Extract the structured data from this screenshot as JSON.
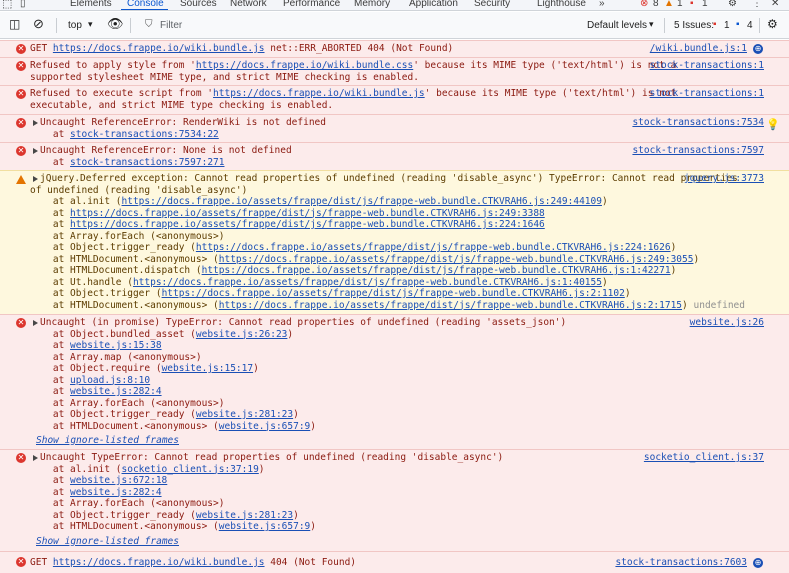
{
  "tabs": [
    "Elements",
    "Console",
    "Sources",
    "Network",
    "Performance",
    "Memory",
    "Application",
    "Security",
    "Lighthouse"
  ],
  "more_tabs": "»",
  "tab_counts": {
    "errors": "8",
    "warnings": "1",
    "info": "1"
  },
  "toolbar": {
    "context": "top",
    "filter_placeholder": "Filter",
    "levels": "Default levels",
    "issues_label": "5 Issues:",
    "issues_err": "1",
    "issues_info": "4"
  },
  "m1": {
    "pre": "GET ",
    "url": "https://docs.frappe.io/wiki.bundle.js",
    "post": " net::ERR_ABORTED 404 (Not Found)",
    "src": "/wiki.bundle.js:1"
  },
  "m2": {
    "l1a": "Refused to apply style from '",
    "l1url": "https://docs.frappe.io/wiki.bundle.css",
    "l1b": "' because its MIME type ('text/html') is not a",
    "l2": "supported stylesheet MIME type, and strict MIME checking is enabled.",
    "src": "stock-transactions:1"
  },
  "m3": {
    "l1a": "Refused to execute script from '",
    "l1url": "https://docs.frappe.io/wiki.bundle.js",
    "l1b": "' because its MIME type ('text/html') is not",
    "l2": "executable, and strict MIME type checking is enabled.",
    "src": "stock-transactions:1"
  },
  "m4": {
    "l1": "Uncaught ReferenceError: RenderWiki is not defined",
    "l2a": "    at ",
    "l2url": "stock-transactions:7534:22",
    "src": "stock-transactions:7534"
  },
  "m5": {
    "l1": "Uncaught ReferenceError: None is not defined",
    "l2a": "    at ",
    "l2url": "stock-transactions:7597:271",
    "src": "stock-transactions:7597"
  },
  "m6": {
    "l1": "jQuery.Deferred exception: Cannot read properties of undefined (reading 'disable_async') TypeError: Cannot read properties",
    "l2": "of undefined (reading 'disable_async')",
    "src": "jquery.js:3773",
    "frames": [
      {
        "a": "    at al.init (",
        "u": "https://docs.frappe.io/assets/frappe/dist/js/frappe-web.bundle.CTKVRAH6.js:249:44109",
        "b": ")"
      },
      {
        "a": "    at ",
        "u": "https://docs.frappe.io/assets/frappe/dist/js/frappe-web.bundle.CTKVRAH6.js:249:3388",
        "b": ""
      },
      {
        "a": "    at ",
        "u": "https://docs.frappe.io/assets/frappe/dist/js/frappe-web.bundle.CTKVRAH6.js:224:1646",
        "b": ""
      },
      {
        "a": "    at Array.forEach (<anonymous>)",
        "u": "",
        "b": ""
      },
      {
        "a": "    at Object.trigger_ready (",
        "u": "https://docs.frappe.io/assets/frappe/dist/js/frappe-web.bundle.CTKVRAH6.js:224:1626",
        "b": ")"
      },
      {
        "a": "    at HTMLDocument.<anonymous> (",
        "u": "https://docs.frappe.io/assets/frappe/dist/js/frappe-web.bundle.CTKVRAH6.js:249:3055",
        "b": ")"
      },
      {
        "a": "    at HTMLDocument.dispatch (",
        "u": "https://docs.frappe.io/assets/frappe/dist/js/frappe-web.bundle.CTKVRAH6.js:1:42271",
        "b": ")"
      },
      {
        "a": "    at Ut.handle (",
        "u": "https://docs.frappe.io/assets/frappe/dist/js/frappe-web.bundle.CTKVRAH6.js:1:40155",
        "b": ")"
      },
      {
        "a": "    at Object.trigger (",
        "u": "https://docs.frappe.io/assets/frappe/dist/js/frappe-web.bundle.CTKVRAH6.js:2:1102",
        "b": ")"
      },
      {
        "a": "    at HTMLDocument.<anonymous> (",
        "u": "https://docs.frappe.io/assets/frappe/dist/js/frappe-web.bundle.CTKVRAH6.js:2:1715",
        "b": ")"
      }
    ],
    "tail": "undefined"
  },
  "m7": {
    "l1": "Uncaught (in promise) TypeError: Cannot read properties of undefined (reading 'assets_json')",
    "src": "website.js:26",
    "frames": [
      {
        "a": "    at Object.bundled_asset (",
        "u": "website.js:26:23",
        "b": ")"
      },
      {
        "a": "    at ",
        "u": "website.js:15:38",
        "b": ""
      },
      {
        "a": "    at Array.map (<anonymous>)",
        "u": "",
        "b": ""
      },
      {
        "a": "    at Object.require (",
        "u": "website.js:15:17",
        "b": ")"
      },
      {
        "a": "    at ",
        "u": "upload.js:8:10",
        "b": ""
      },
      {
        "a": "    at ",
        "u": "website.js:282:4",
        "b": ""
      },
      {
        "a": "    at Array.forEach (<anonymous>)",
        "u": "",
        "b": ""
      },
      {
        "a": "    at Object.trigger_ready (",
        "u": "website.js:281:23",
        "b": ")"
      },
      {
        "a": "    at HTMLDocument.<anonymous> (",
        "u": "website.js:657:9",
        "b": ")"
      }
    ],
    "show": "Show ignore-listed frames"
  },
  "m8": {
    "l1": "Uncaught TypeError: Cannot read properties of undefined (reading 'disable_async')",
    "src": "socketio_client.js:37",
    "frames": [
      {
        "a": "    at al.init (",
        "u": "socketio_client.js:37:19",
        "b": ")"
      },
      {
        "a": "    at ",
        "u": "website.js:672:18",
        "b": ""
      },
      {
        "a": "    at ",
        "u": "website.js:282:4",
        "b": ""
      },
      {
        "a": "    at Array.forEach (<anonymous>)",
        "u": "",
        "b": ""
      },
      {
        "a": "    at Object.trigger_ready (",
        "u": "website.js:281:23",
        "b": ")"
      },
      {
        "a": "    at HTMLDocument.<anonymous> (",
        "u": "website.js:657:9",
        "b": ")"
      }
    ],
    "show": "Show ignore-listed frames"
  },
  "m9": {
    "pre": "GET ",
    "url": "https://docs.frappe.io/wiki.bundle.js",
    "post": " 404 (Not Found)",
    "src": "stock-transactions:7603"
  }
}
